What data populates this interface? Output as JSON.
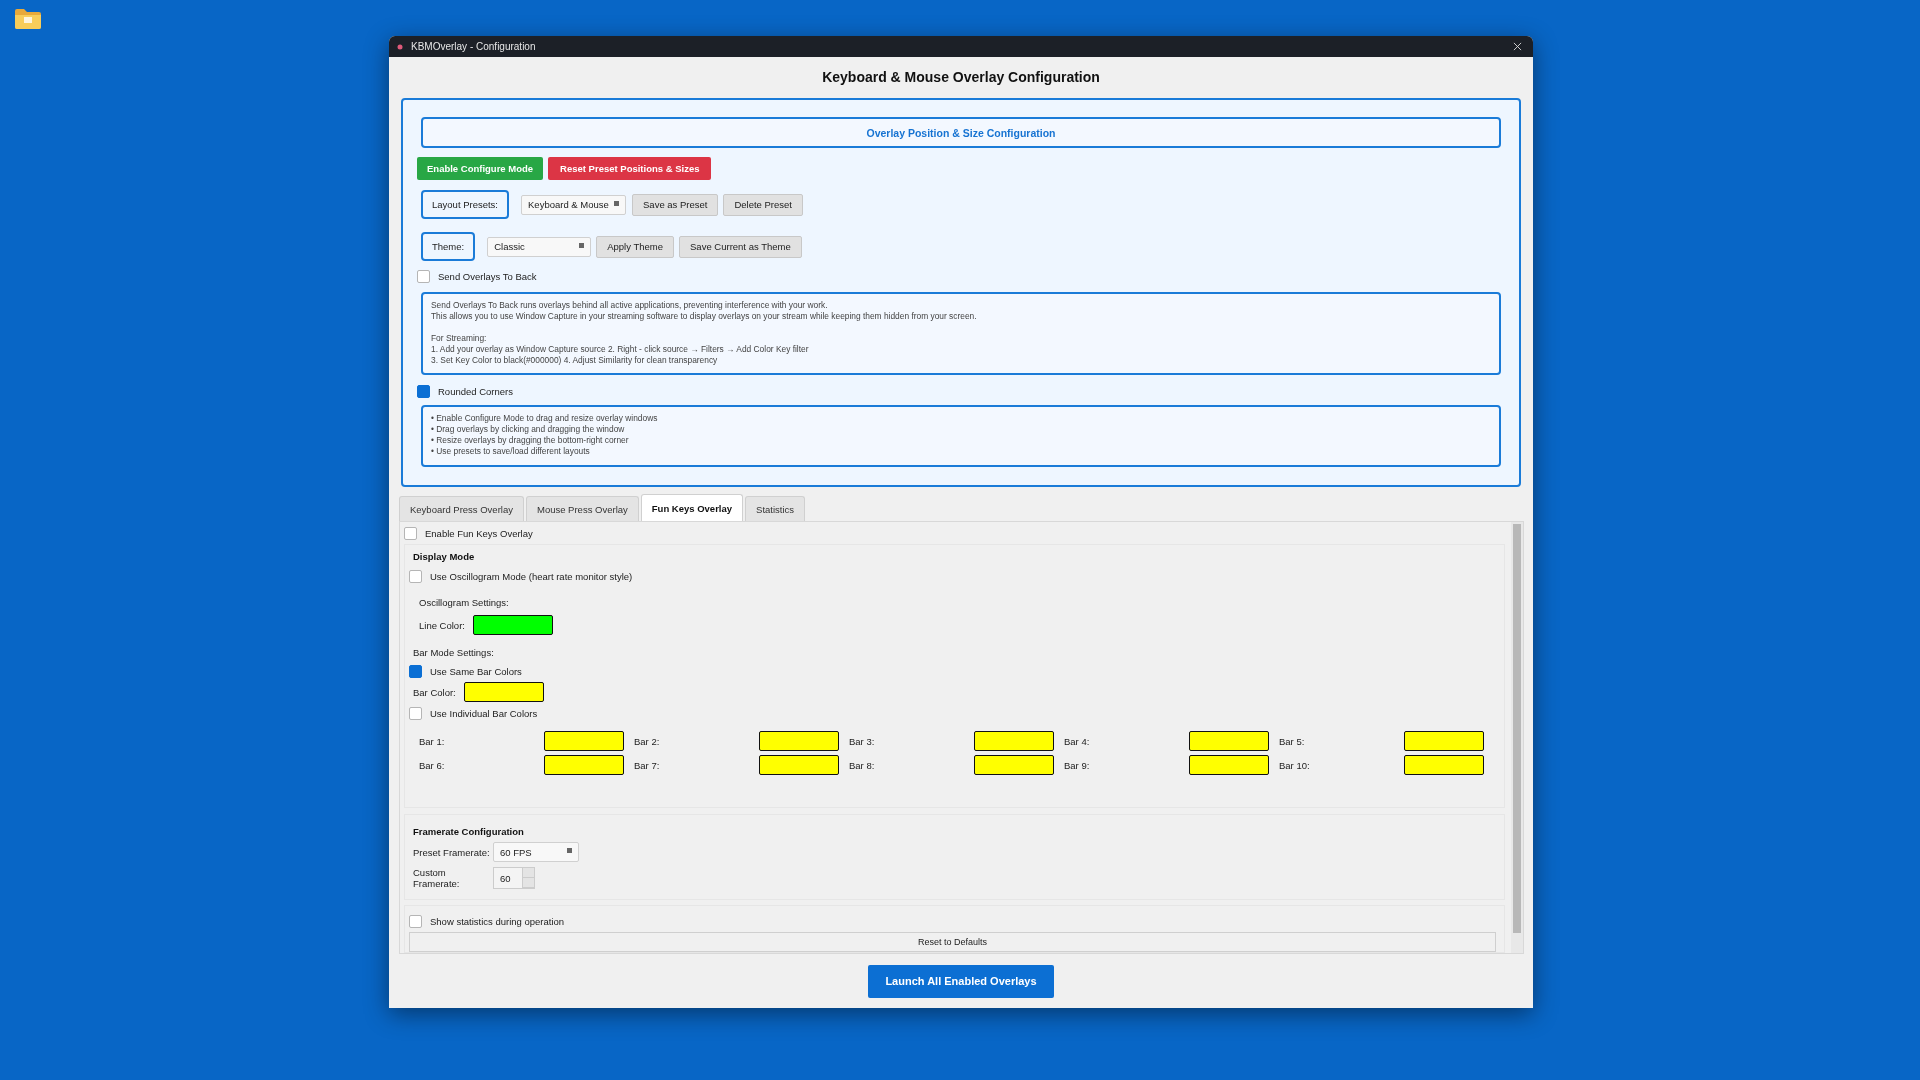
{
  "window": {
    "title": "KBMOverlay - Configuration"
  },
  "heading": "Keyboard & Mouse Overlay Configuration",
  "position_panel": {
    "title": "Overlay Position & Size Configuration",
    "configure_button": "Enable Configure Mode",
    "reset_button": "Reset Preset Positions & Sizes",
    "layout_presets": {
      "label": "Layout Presets:",
      "value": "Keyboard & Mouse",
      "buttons": [
        "Save as Preset",
        "Delete Preset"
      ]
    },
    "theme": {
      "label": "Theme:",
      "value": "Classic",
      "buttons": [
        "Apply Theme",
        "Save Current as Theme"
      ]
    },
    "send_to_back": {
      "label": "Send Overlays To Back",
      "checked": false
    },
    "send_to_back_info": [
      [
        "Send Overlays To Back runs overlays behind all active applications, preventing interference with your work.",
        "This allows you to use Window Capture in your streaming software to display overlays on your stream while keeping them hidden from your screen."
      ],
      [
        "For Streaming:",
        "1. Add your overlay as Window Capture source 2. Right - click source → Filters → Add Color Key filter",
        "3. Set Key Color to black(#000000) 4. Adjust Similarity for clean transparency"
      ]
    ],
    "rounded_corners": {
      "label": "Rounded Corners",
      "checked": true
    },
    "tips": [
      "• Enable Configure Mode to drag and resize overlay windows",
      "• Drag overlays by clicking and dragging the window",
      "• Resize overlays by dragging the bottom-right corner",
      "• Use presets to save/load different layouts"
    ]
  },
  "tabs": [
    {
      "label": "Keyboard Press Overlay",
      "selected": false
    },
    {
      "label": "Mouse Press Overlay",
      "selected": false
    },
    {
      "label": "Fun Keys Overlay",
      "selected": true
    },
    {
      "label": "Statistics",
      "selected": false
    }
  ],
  "fun_keys": {
    "enable": {
      "label": "Enable Fun Keys Overlay",
      "checked": false
    },
    "display_mode": {
      "title": "Display Mode",
      "oscillogram": {
        "label": "Use Oscillogram Mode (heart rate monitor style)",
        "checked": false
      },
      "oscillogram_settings": "Oscillogram Settings:",
      "line_color": {
        "label": "Line Color:",
        "color": "#00ff00"
      },
      "bar_mode_settings": "Bar Mode Settings:",
      "same_colors": {
        "label": "Use Same Bar Colors",
        "checked": true
      },
      "bar_color": {
        "label": "Bar Color:",
        "color": "#ffff00"
      },
      "individual_colors": {
        "label": "Use Individual Bar Colors",
        "checked": false
      },
      "bars": [
        {
          "label": "Bar 1:",
          "color": "#ffff00"
        },
        {
          "label": "Bar 2:",
          "color": "#ffff00"
        },
        {
          "label": "Bar 3:",
          "color": "#ffff00"
        },
        {
          "label": "Bar 4:",
          "color": "#ffff00"
        },
        {
          "label": "Bar 5:",
          "color": "#ffff00"
        },
        {
          "label": "Bar 6:",
          "color": "#ffff00"
        },
        {
          "label": "Bar 7:",
          "color": "#ffff00"
        },
        {
          "label": "Bar 8:",
          "color": "#ffff00"
        },
        {
          "label": "Bar 9:",
          "color": "#ffff00"
        },
        {
          "label": "Bar 10:",
          "color": "#ffff00"
        }
      ]
    },
    "framerate": {
      "title": "Framerate Configuration",
      "preset": {
        "label": "Preset Framerate:",
        "value": "60 FPS"
      },
      "custom": {
        "label": "Custom Framerate:",
        "value": "60"
      }
    },
    "show_statistics": {
      "label": "Show statistics during operation",
      "checked": false
    },
    "reset_button": "Reset to Defaults"
  },
  "launch_button": "Launch All Enabled Overlays"
}
